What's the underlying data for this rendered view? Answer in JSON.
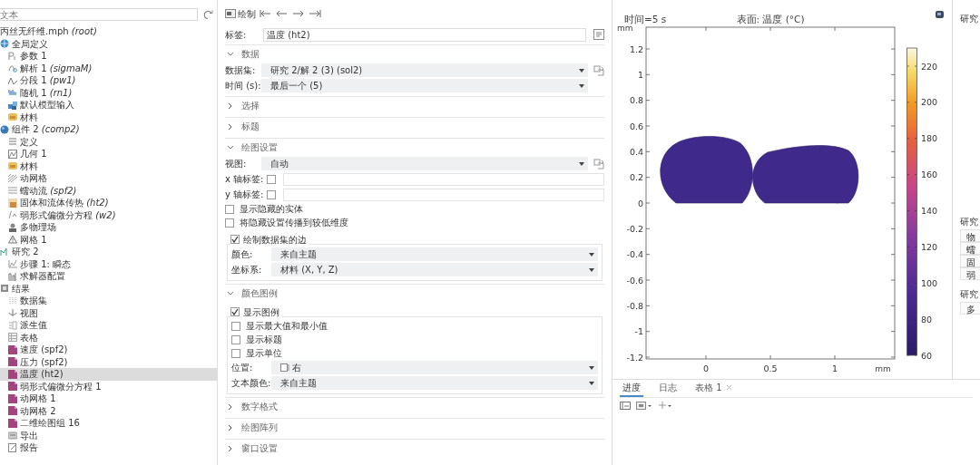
{
  "tree": {
    "search": {
      "placeholder": "文本"
    },
    "items": [
      {
        "label": "丙丝无纤维.mph *(root)*",
        "selected": false,
        "children": [
          {
            "label": "全局定义",
            "kind": "global",
            "selected": false,
            "children": [
              {
                "label": "参数 1",
                "kind": "param",
                "selected": false
              },
              {
                "label": "解析 1 *(sigmaM)*",
                "kind": "analytic",
                "selected": false
              },
              {
                "label": "分段 1 *(pw1)*",
                "kind": "piecewise",
                "selected": false
              },
              {
                "label": "随机 1 *(rn1)*",
                "kind": "random",
                "selected": false
              },
              {
                "label": "默认模型输入",
                "kind": "model",
                "selected": false
              },
              {
                "label": "材料",
                "kind": "material",
                "selected": false
              }
            ]
          },
          {
            "label": "组件 2 *(comp2)*",
            "kind": "component",
            "selected": false,
            "children": [
              {
                "label": "定义",
                "kind": "definitions",
                "selected": false
              },
              {
                "label": "几何 1",
                "kind": "geometry",
                "selected": false
              },
              {
                "label": "材料",
                "kind": "material",
                "selected": false
              },
              {
                "label": "动网格",
                "kind": "moving",
                "selected": false
              },
              {
                "label": "蠕动流 *(spf2)*",
                "kind": "flow",
                "selected": false
              },
              {
                "label": "固体和流体传热 *(ht2)*",
                "kind": "heat",
                "selected": false
              },
              {
                "label": "弱形式偏微分方程 *(w2)*",
                "kind": "pde",
                "selected": false
              },
              {
                "label": "多物理场",
                "kind": "multi",
                "selected": false
              },
              {
                "label": "网格 1",
                "kind": "mesh",
                "selected": false
              }
            ]
          },
          {
            "label": "研究 2",
            "kind": "study",
            "selected": false,
            "children": [
              {
                "label": "步骤 1: 瞬态",
                "kind": "step",
                "selected": false
              },
              {
                "label": "求解器配置",
                "kind": "solver",
                "selected": false
              }
            ]
          },
          {
            "label": "结果",
            "kind": "results",
            "selected": false,
            "children": [
              {
                "label": "数据集",
                "kind": "dataset",
                "selected": false
              },
              {
                "label": "视图",
                "kind": "view",
                "selected": false
              },
              {
                "label": "派生值",
                "kind": "derived",
                "selected": false
              },
              {
                "label": "表格",
                "kind": "table",
                "selected": false
              },
              {
                "label": "速度 (spf2)",
                "kind": "plot",
                "selected": false
              },
              {
                "label": "压力 (spf2)",
                "kind": "plot",
                "selected": false
              },
              {
                "label": "温度 (ht2)",
                "kind": "plot",
                "selected": true
              },
              {
                "label": "弱形式偏微分方程 1",
                "kind": "plot",
                "selected": false
              },
              {
                "label": "动网格 1",
                "kind": "plot",
                "selected": false
              },
              {
                "label": "动网格 2",
                "kind": "plot",
                "selected": false
              },
              {
                "label": "二维绘图组 16",
                "kind": "plot",
                "selected": false
              },
              {
                "label": "导出",
                "kind": "export",
                "selected": false
              },
              {
                "label": "报告",
                "kind": "report",
                "selected": false
              }
            ]
          }
        ]
      }
    ]
  },
  "settings": {
    "plot_button": "绘制",
    "label": {
      "caption": "标签:",
      "value": "温度 (ht2)"
    },
    "sections": [
      {
        "title": "数据",
        "expanded": true,
        "rows": [
          {
            "kind": "select",
            "caption": "数据集:",
            "value": "研究 2/解 2 (3) (sol2)",
            "side_icon": true
          },
          {
            "kind": "select",
            "caption": "时间 (s):",
            "value": "最后一个 (5)"
          }
        ]
      },
      {
        "title": "选择",
        "expanded": false
      },
      {
        "title": "标题",
        "expanded": false
      },
      {
        "title": "绘图设置",
        "expanded": true,
        "rows": [
          {
            "kind": "select",
            "caption": "视图:",
            "value": "自动",
            "side_icon": true
          },
          {
            "kind": "checkfield",
            "caption": "x 轴标签:",
            "checked": false
          },
          {
            "kind": "checkfield",
            "caption": "y 轴标签:",
            "checked": false
          },
          {
            "kind": "check",
            "caption": "显示隐藏的实体",
            "checked": false
          },
          {
            "kind": "check",
            "caption": "将隐藏设置传播到较低维度",
            "checked": false
          },
          {
            "kind": "group",
            "caption": "绘制数据集的边",
            "checked": true,
            "rows": [
              {
                "kind": "select",
                "caption": "颜色:",
                "value": "来自主题"
              },
              {
                "kind": "select",
                "caption": "坐标系:",
                "value": "材料  (X, Y, Z)"
              }
            ]
          }
        ]
      },
      {
        "title": "颜色图例",
        "expanded": true,
        "rows": [
          {
            "kind": "group",
            "caption": "显示图例",
            "checked": true,
            "rows": [
              {
                "kind": "check",
                "caption": "显示最大值和最小值",
                "checked": false
              },
              {
                "kind": "check",
                "caption": "显示标题",
                "checked": false
              },
              {
                "kind": "check",
                "caption": "显示单位",
                "checked": false
              },
              {
                "kind": "select",
                "caption": "位置:",
                "value": "右",
                "value_icon": true
              },
              {
                "kind": "select",
                "caption": "文本颜色:",
                "value": "来自主题"
              }
            ]
          }
        ]
      },
      {
        "title": "数字格式",
        "expanded": false
      },
      {
        "title": "绘图阵列",
        "expanded": false
      },
      {
        "title": "窗口设置",
        "expanded": false
      }
    ]
  },
  "plot": {
    "time_label": "时间=5 s",
    "title": "表面: 温度 (°C)",
    "y_unit": "mm",
    "x_unit": "mm",
    "yticks": [
      "1.2",
      "1",
      "0.8",
      "0.6",
      "0.4",
      "0.2",
      "0",
      "-0.2",
      "-0.4",
      "-0.6",
      "-0.8",
      "-1",
      "-1.2"
    ],
    "xticks": [
      "0",
      "0.5",
      "1"
    ],
    "colorbar_ticks": [
      "220",
      "200",
      "180",
      "160",
      "140",
      "120",
      "100",
      "80",
      "60"
    ]
  },
  "side_panel": {
    "sections": [
      {
        "title": "研究"
      },
      {
        "title": "研究",
        "cells": [
          "物",
          "蠕",
          "固",
          "弱"
        ]
      },
      {
        "title": "研究",
        "cells": [
          "多"
        ]
      }
    ]
  },
  "bottom_panel": {
    "tabs": [
      {
        "label": "进度",
        "selected": true,
        "closable": false
      },
      {
        "label": "日志",
        "selected": false,
        "closable": false
      },
      {
        "label": "表格 1",
        "selected": false,
        "closable": true
      }
    ]
  }
}
